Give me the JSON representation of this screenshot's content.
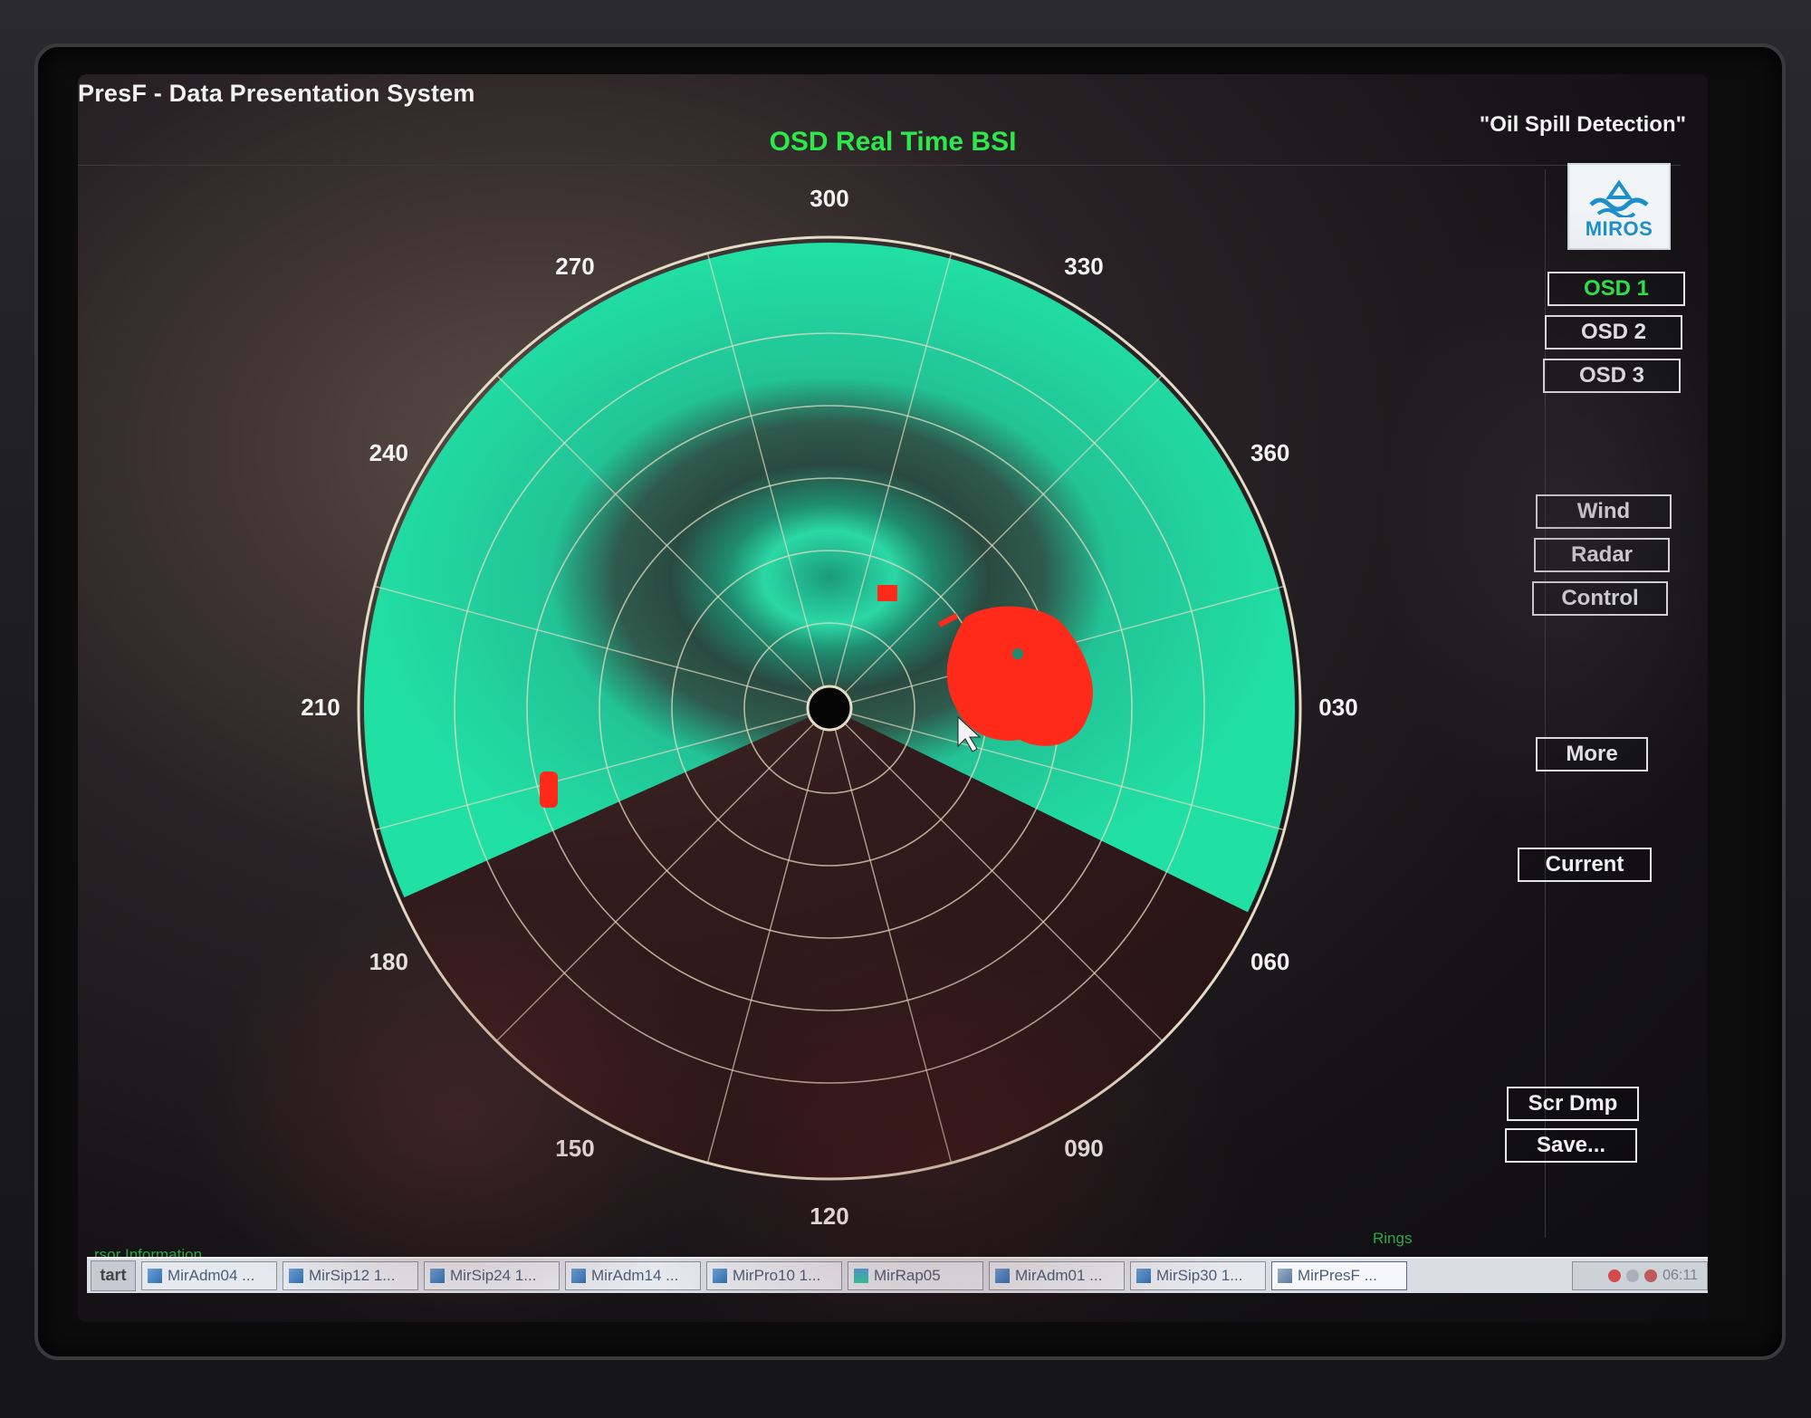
{
  "app": {
    "title": "PresF - Data Presentation System",
    "view_title": "OSD Real Time BSI",
    "mode_title": "\"Oil Spill Detection\""
  },
  "logo": {
    "text": "MIROS",
    "icon": "miros-wave-logo-icon"
  },
  "osd_buttons": [
    {
      "label": "OSD 1",
      "active": true
    },
    {
      "label": "OSD 2",
      "active": false
    },
    {
      "label": "OSD 3",
      "active": false
    }
  ],
  "panel_buttons": {
    "wind": "Wind",
    "radar": "Radar",
    "control": "Control",
    "more": "More",
    "current": "Current",
    "scr_dmp": "Scr Dmp",
    "save": "Save..."
  },
  "radar": {
    "bearing_labels": [
      "300",
      "330",
      "360",
      "030",
      "060",
      "090",
      "120",
      "150",
      "180",
      "210",
      "240",
      "270"
    ],
    "colors": {
      "sea": "#21e0a4",
      "oil": "#ff2a1a",
      "rings": "#e4dcc4"
    }
  },
  "status": {
    "cursor_info_label": "rsor Information",
    "rings_label": "Rings"
  },
  "taskbar": {
    "start_label": "tart",
    "items": [
      "MirAdm04 ...",
      "MirSip12 1...",
      "MirSip24 1...",
      "MirAdm14 ...",
      "MirPro10 1...",
      "MirRap05",
      "MirAdm01 ...",
      "MirSip30 1...",
      "MirPresF ..."
    ],
    "active_index": 8,
    "clock": "06:11"
  }
}
